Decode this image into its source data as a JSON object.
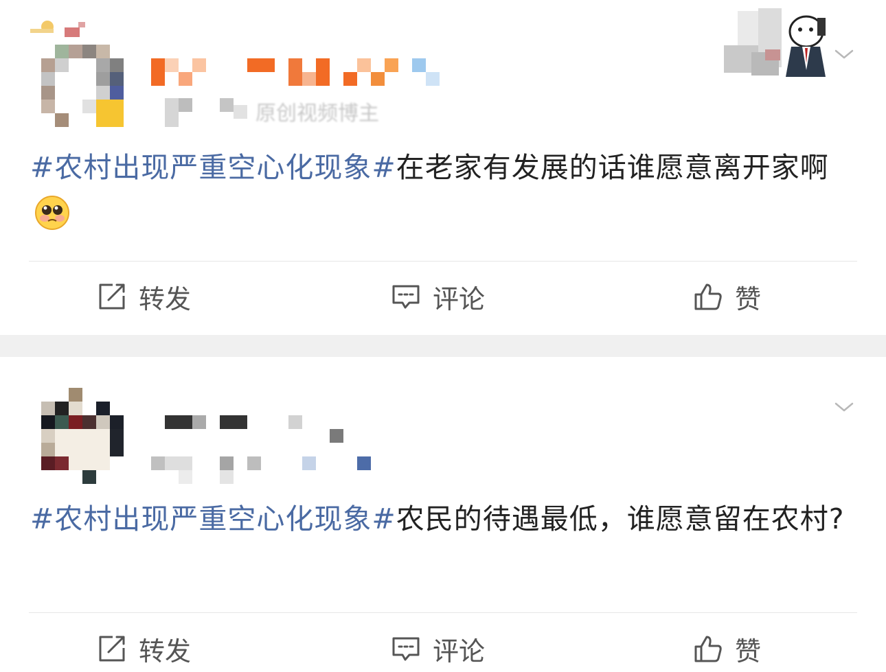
{
  "posts": [
    {
      "author_subtitle_fragment": "原创视频博主",
      "topic": "#农村出现严重空心化现象#",
      "body": "在老家有发展的话谁愿意离开家啊",
      "emoji": "pleading-face",
      "actions": {
        "repost": "转发",
        "comment": "评论",
        "like": "赞"
      }
    },
    {
      "topic": "#农村出现严重空心化现象#",
      "body": "农民的待遇最低，谁愿意留在农村?",
      "actions": {
        "repost": "转发",
        "comment": "评论",
        "like": "赞"
      }
    }
  ],
  "icons": {
    "repost": "repost-icon",
    "comment": "comment-icon",
    "like": "thumbs-up-icon",
    "menu": "chevron-down-icon"
  },
  "colors": {
    "topic": "#4a6aa3",
    "text": "#222222",
    "action": "#555555",
    "separator": "#f0f0f0"
  }
}
